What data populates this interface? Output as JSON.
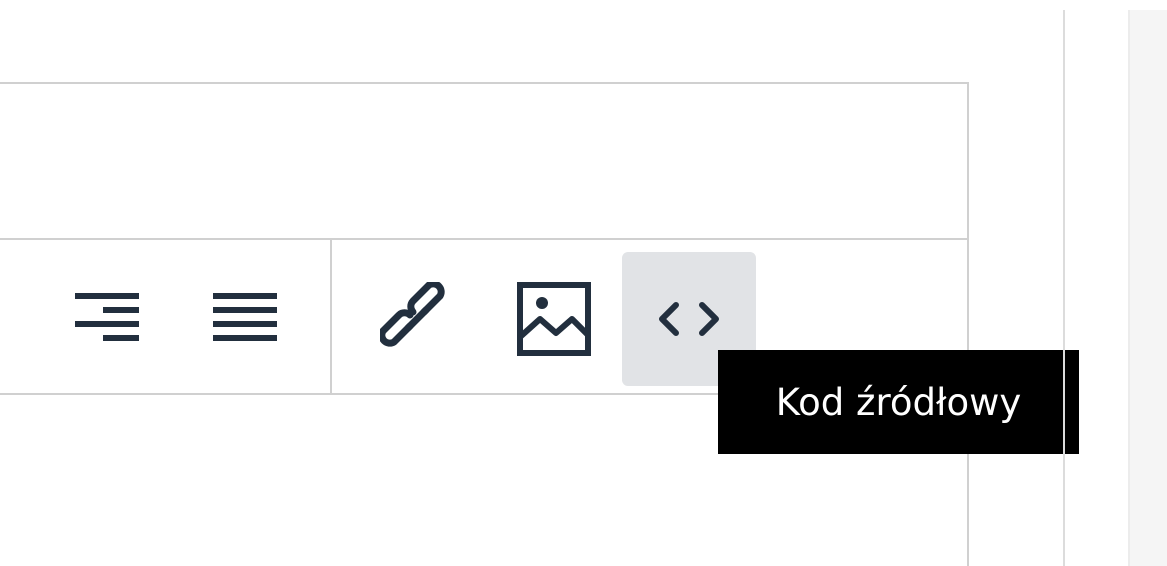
{
  "toolbar": {
    "buttons": [
      {
        "id": "align-right",
        "icon": "align-right-icon",
        "active": false
      },
      {
        "id": "justify",
        "icon": "align-justify-icon",
        "active": false
      },
      {
        "id": "link",
        "icon": "link-icon",
        "active": false
      },
      {
        "id": "image",
        "icon": "image-icon",
        "active": false
      },
      {
        "id": "source-code",
        "icon": "code-icon",
        "active": true
      }
    ],
    "active_button_color": "#e1e3e6",
    "icon_color": "#222f3e"
  },
  "tooltip": {
    "text": "Kod źródłowy"
  }
}
